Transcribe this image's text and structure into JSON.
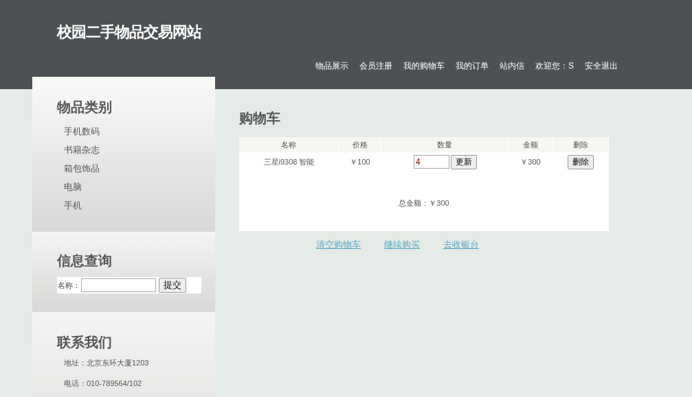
{
  "site_title": "校园二手物品交易网站",
  "nav": [
    "物品展示",
    "会员注册",
    "我的购物车",
    "我的订单",
    "站内信",
    "欢迎您：S",
    "安全退出"
  ],
  "sidebar": {
    "categories": {
      "title": "物品类别",
      "items": [
        "手机数码",
        "书籍杂志",
        "箱包饰品",
        "电脑",
        "手机"
      ]
    },
    "search": {
      "title": "信息查询",
      "label": "名称：",
      "button": "提交"
    },
    "contact": {
      "title": "联系我们",
      "lines": [
        "地址：北京东环大厦1203",
        "电话：010-789564/102"
      ]
    }
  },
  "cart": {
    "title": "购物车",
    "columns": [
      "名称",
      "价格",
      "数量",
      "金额",
      "删除"
    ],
    "rows": [
      {
        "name": "三星i9308 智能",
        "price": "￥100",
        "quantity": "4",
        "update_button": "更新",
        "amount": "￥300",
        "delete_button": "删除"
      }
    ],
    "total": "总金额：￥300",
    "links": [
      "清空购物车",
      "继续购买",
      "去收银台"
    ]
  }
}
